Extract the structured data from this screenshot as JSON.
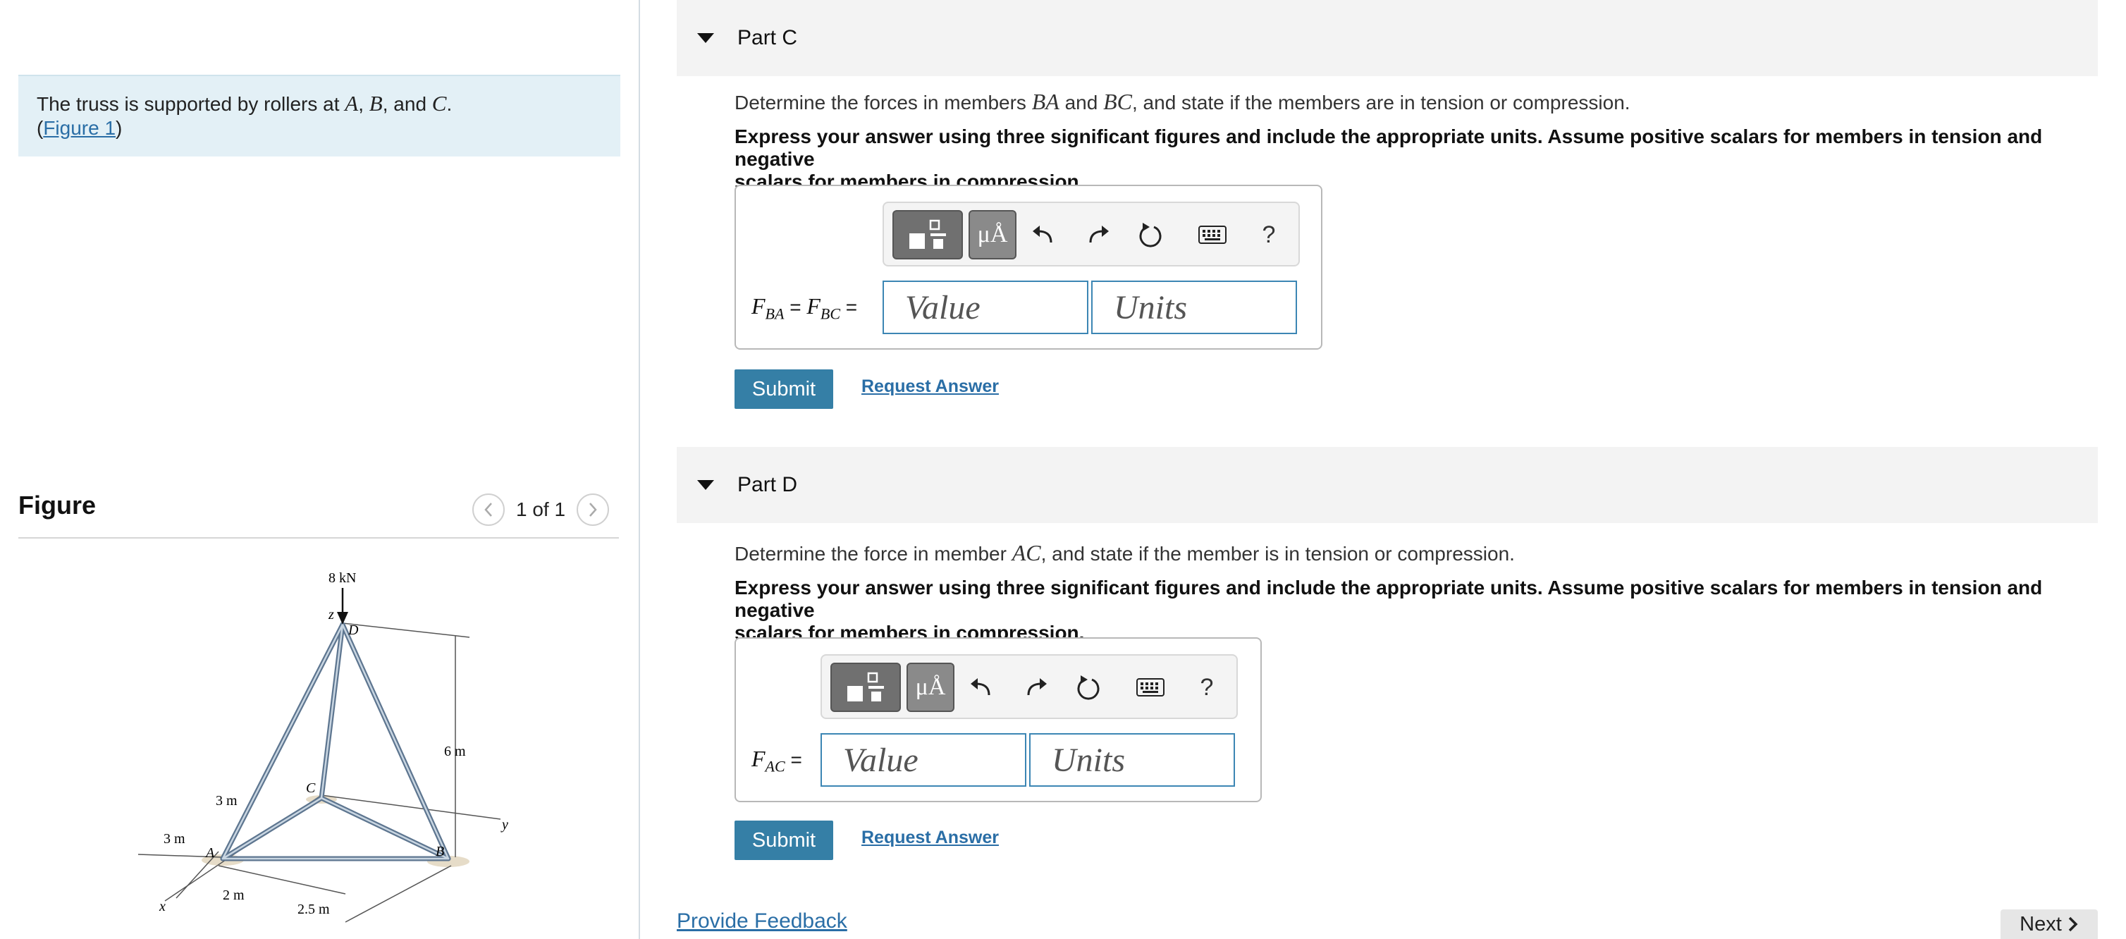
{
  "intro": {
    "text_prefix": "The truss is supported by rollers at ",
    "A": "A",
    "sep1": ", ",
    "B": "B",
    "sep2": ", and ",
    "C": "C",
    "period": ".",
    "paren_open": "(",
    "figure_link": "Figure 1",
    "paren_close": ")"
  },
  "figure": {
    "title": "Figure",
    "pager": "1 of 1",
    "labels": {
      "load": "8 kN",
      "z": "z",
      "D": "D",
      "C": "C",
      "A": "A",
      "B": "B",
      "x": "x",
      "y": "y",
      "h6": "6 m",
      "d3a": "3 m",
      "d3b": "3 m",
      "d2": "2 m",
      "d25": "2.5 m"
    }
  },
  "partC": {
    "title": "Part C",
    "q_prefix": "Determine the forces in members ",
    "q_m1": "BA",
    "q_and": " and ",
    "q_m2": "BC",
    "q_suffix": ", and state if the members are in tension or compression.",
    "instruction_line1": "Express your answer using three significant figures and include the appropriate units. Assume positive scalars for members in tension and negative",
    "instruction_line2": "scalars for members in compression.",
    "label_F1": "F",
    "label_sub1": "BA",
    "label_eq1": " = ",
    "label_F2": "F",
    "label_sub2": "BC",
    "label_eq2": " =",
    "value_placeholder": "Value",
    "units_placeholder": "Units",
    "submit": "Submit",
    "request": "Request Answer"
  },
  "partD": {
    "title": "Part D",
    "q_prefix": "Determine the force in member ",
    "q_m1": "AC",
    "q_suffix": ", and state if the member is in tension or compression.",
    "instruction_line1": "Express your answer using three significant figures and include the appropriate units. Assume positive scalars for members in tension and negative",
    "instruction_line2": "scalars for members in compression.",
    "label_F": "F",
    "label_sub": "AC",
    "label_eq": " =",
    "value_placeholder": "Value",
    "units_placeholder": "Units",
    "submit": "Submit",
    "request": "Request Answer"
  },
  "toolbar": {
    "units_symbol": "μÅ",
    "help": "?"
  },
  "footer": {
    "feedback": "Provide Feedback",
    "next": "Next"
  },
  "colors": {
    "accent": "#357fa6",
    "link": "#2a6ea6",
    "field_border": "#3c86b4",
    "intro_bg": "#e3f0f6"
  }
}
